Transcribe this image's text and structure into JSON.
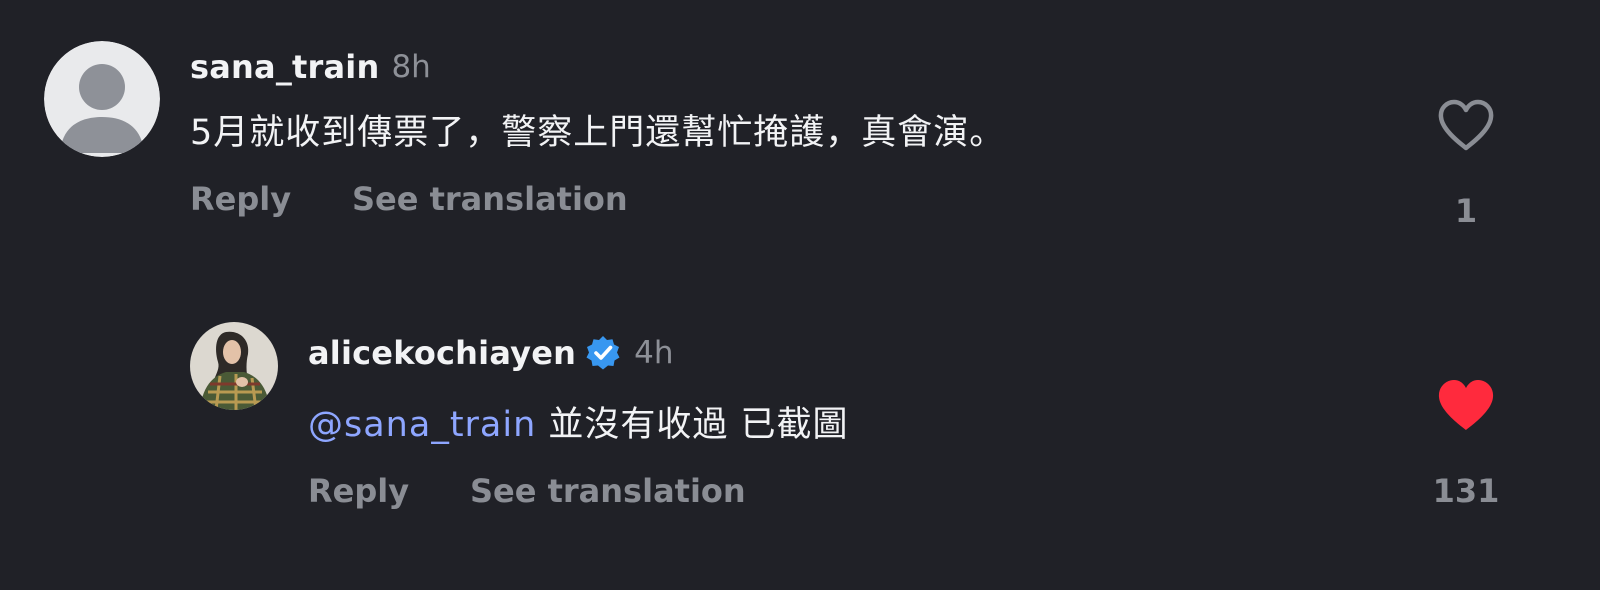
{
  "comments": [
    {
      "username": "sana_train",
      "time": "8h",
      "text": "5月就收到傳票了，警察上門還幫忙掩護，真會演。",
      "actions": {
        "reply": "Reply",
        "translate": "See translation"
      },
      "likes": "1",
      "liked": false,
      "verified": false,
      "avatar_icon": "default-user-avatar"
    },
    {
      "username": "alicekochiayen",
      "time": "4h",
      "mention": "@sana_train",
      "text": " 並沒有收過 已截圖",
      "actions": {
        "reply": "Reply",
        "translate": "See translation"
      },
      "likes": "131",
      "liked": true,
      "verified": true,
      "avatar_icon": "profile-photo-avatar"
    }
  ],
  "colors": {
    "background": "#202127",
    "text_primary": "#f2f3f5",
    "text_secondary": "#8a8d94",
    "mention": "#8ea6ff",
    "liked_heart": "#ff2a3d",
    "verified_badge": "#3897f0"
  }
}
